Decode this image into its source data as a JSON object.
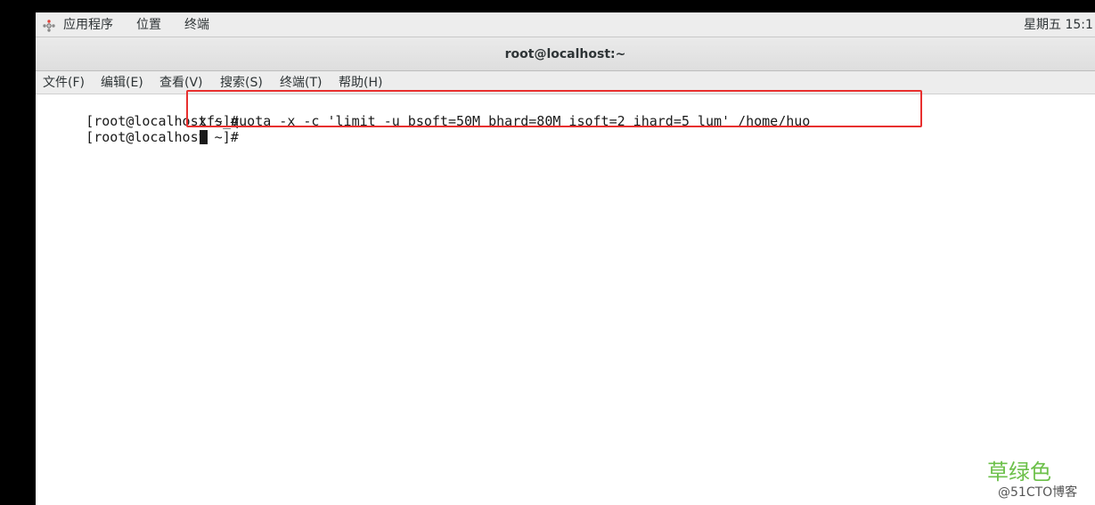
{
  "top_panel": {
    "applications": "应用程序",
    "places": "位置",
    "terminal": "终端",
    "clock": "星期五 15:1"
  },
  "window": {
    "title": "root@localhost:~"
  },
  "menu": {
    "items": [
      {
        "label": "文件(F)"
      },
      {
        "label": "编辑(E)"
      },
      {
        "label": "查看(V)"
      },
      {
        "label": "搜索(S)"
      },
      {
        "label": "终端(T)"
      },
      {
        "label": "帮助(H)"
      }
    ]
  },
  "terminal": {
    "lines": [
      {
        "prompt": "[root@localhost ~]#",
        "command": "xfs_quota -x -c 'limit -u bsoft=50M bhard=80M isoft=2 ihard=5 lum' /home/huo"
      },
      {
        "prompt": "[root@localhost ~]#",
        "command": ""
      }
    ]
  },
  "annotation": {
    "color": "#e8302f"
  },
  "watermark": {
    "main": "草绿色",
    "sub": "@51CTO博客"
  },
  "colors": {
    "panel_bg": "#ededed",
    "terminal_bg": "#ffffff",
    "terminal_fg": "#1a1a1a",
    "watermark_green": "#6cc04a"
  }
}
